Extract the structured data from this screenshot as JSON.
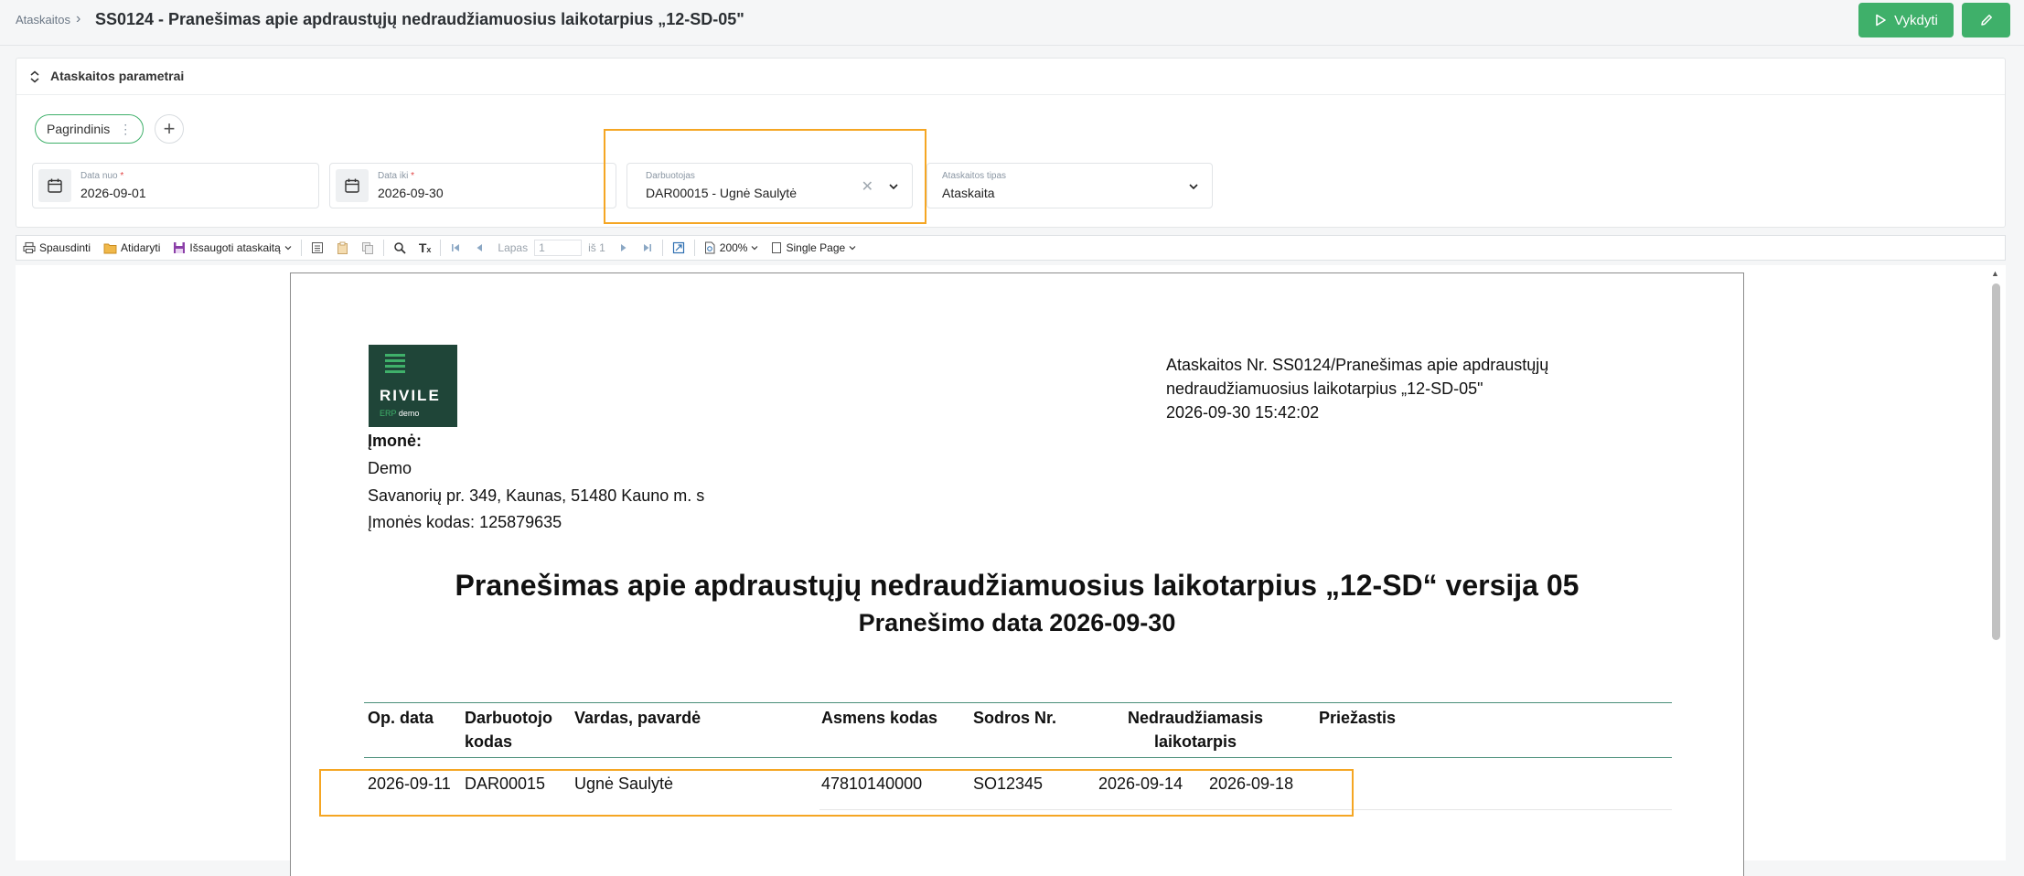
{
  "header": {
    "breadcrumb": "Ataskaitos",
    "breadcrumb_sep": "›",
    "title": "SS0124 - Pranešimas apie apdraustųjų nedraudžiamuosius laikotarpius „12-SD-05\"",
    "run_label": "Vykdyti"
  },
  "params": {
    "title": "Ataskaitos parametrai",
    "chip_label": "Pagrindinis",
    "date_from": {
      "label": "Data nuo",
      "value": "2026-09-01"
    },
    "date_to": {
      "label": "Data iki",
      "value": "2026-09-30"
    },
    "employee": {
      "label": "Darbuotojas",
      "value": "DAR00015 - Ugnė Saulytė"
    },
    "report_type": {
      "label": "Ataskaitos tipas",
      "value": "Ataskaita"
    }
  },
  "toolbar": {
    "print": "Spausdinti",
    "open": "Atidaryti",
    "save": "Išsaugoti ataskaitą",
    "page_label": "Lapas",
    "page_value": "1",
    "page_of": "iš 1",
    "zoom": "200%",
    "view_mode": "Single Page"
  },
  "document": {
    "logo_text": "RIVILE",
    "logo_sub_erp": "ERP",
    "logo_sub_demo": "demo",
    "report_no_line1": "Ataskaitos Nr. SS0124/Pranešimas apie apdraustųjų",
    "report_no_line2": "nedraudžiamuosius laikotarpius „12-SD-05\"",
    "report_datetime": "2026-09-30 15:42:02",
    "company_label": "Įmonė:",
    "company_name": "Demo",
    "company_address": "Savanorių pr. 349, Kaunas, 51480 Kauno m. s",
    "company_code": "Įmonės kodas: 125879635",
    "title": "Pranešimas apie apdraustųjų nedraudžiamuosius laikotarpius „12-SD“  versija 05",
    "subtitle": "Pranešimo data 2026-09-30",
    "columns": {
      "op_date": "Op. data",
      "emp_code_1": "Darbuotojo",
      "emp_code_2": "kodas",
      "name": "Vardas, pavardė",
      "personal_code": "Asmens kodas",
      "sodra_no": "Sodros Nr.",
      "period_1": "Nedraudžiamasis",
      "period_2": "laikotarpis",
      "reason": "Priežastis"
    },
    "rows": [
      {
        "op_date": "2026-09-11",
        "emp_code": "DAR00015",
        "name": "Ugnė Saulytė",
        "personal_code": "47810140000",
        "sodra_no": "SO12345",
        "period_from": "2026-09-14",
        "period_to": "2026-09-18",
        "reason": ""
      }
    ]
  }
}
